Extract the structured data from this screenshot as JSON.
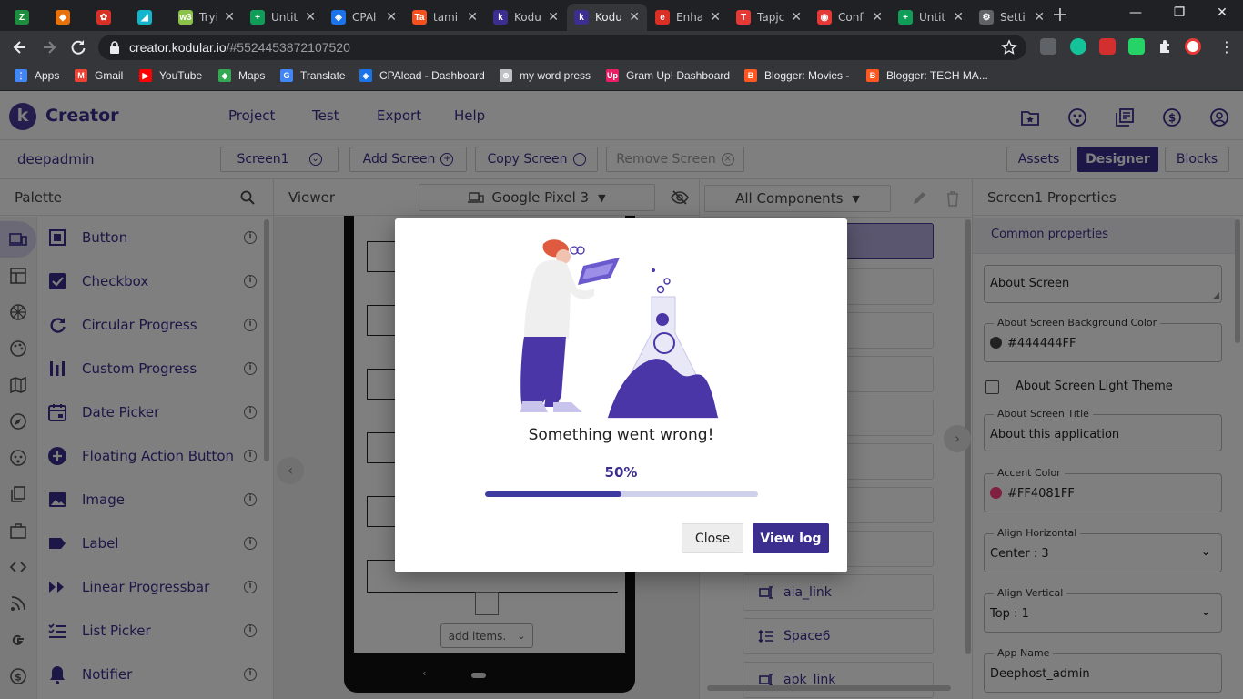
{
  "browser": {
    "tabs": [
      {
        "label": "",
        "color": "#1e8e3e",
        "glyph": "Z"
      },
      {
        "label": "",
        "color": "#e8710a",
        "glyph": "◆"
      },
      {
        "label": "",
        "color": "#d93025",
        "glyph": "✿"
      },
      {
        "label": "",
        "color": "#12b5cb",
        "glyph": "◢"
      },
      {
        "label": "Tryit",
        "color": "#8bc34a",
        "glyph": "w3"
      },
      {
        "label": "Untit",
        "color": "#0f9d58",
        "glyph": "+"
      },
      {
        "label": "CPAl",
        "color": "#1a73e8",
        "glyph": "◈"
      },
      {
        "label": "tami",
        "color": "#f4511e",
        "glyph": "Ta"
      },
      {
        "label": "Kodu",
        "color": "#3b2e8e",
        "glyph": "k"
      },
      {
        "label": "Kodu",
        "color": "#3b2e8e",
        "glyph": "k"
      },
      {
        "label": "Enha",
        "color": "#d93025",
        "glyph": "e"
      },
      {
        "label": "Tapjc",
        "color": "#e53935",
        "glyph": "T"
      },
      {
        "label": "Conf",
        "color": "#e53935",
        "glyph": "◉"
      },
      {
        "label": "Untit",
        "color": "#0f9d58",
        "glyph": "+"
      },
      {
        "label": "Setti",
        "color": "#5f6368",
        "glyph": "⚙"
      }
    ],
    "new_tab": "+",
    "window_controls": [
      "—",
      "❐",
      "✕"
    ],
    "url": "creator.kodular.io",
    "url_path": "/#5524453872107520",
    "bookmarks": [
      {
        "label": "Apps",
        "color": "#4285f4",
        "glyph": "⋮"
      },
      {
        "label": "Gmail",
        "color": "#ea4335",
        "glyph": "M"
      },
      {
        "label": "YouTube",
        "color": "#ff0000",
        "glyph": "▶"
      },
      {
        "label": "Maps",
        "color": "#34a853",
        "glyph": "◆"
      },
      {
        "label": "Translate",
        "color": "#4285f4",
        "glyph": "G"
      },
      {
        "label": "CPAlead - Dashboard",
        "color": "#1a73e8",
        "glyph": "◈"
      },
      {
        "label": "my word press",
        "color": "#bdc1c6",
        "glyph": "⊕"
      },
      {
        "label": "Gram Up! Dashboard",
        "color": "#e91e63",
        "glyph": "Up"
      },
      {
        "label": "Blogger: Movies -",
        "color": "#ff5722",
        "glyph": "B"
      },
      {
        "label": "Blogger: TECH MA...",
        "color": "#ff5722",
        "glyph": "B"
      }
    ]
  },
  "app": {
    "brand": "Creator",
    "logo_letter": "k",
    "menu": [
      "Project",
      "Test",
      "Export",
      "Help"
    ],
    "project_name": "deepadmin",
    "screen_select": "Screen1",
    "add_screen": "Add Screen",
    "copy_screen": "Copy Screen",
    "remove_screen": "Remove Screen",
    "assets": "Assets",
    "designer": "Designer",
    "blocks": "Blocks"
  },
  "palette": {
    "title": "Palette",
    "items": [
      {
        "label": "Button",
        "icon": "button-icon"
      },
      {
        "label": "Checkbox",
        "icon": "checkbox-icon"
      },
      {
        "label": "Circular Progress",
        "icon": "circular-progress-icon"
      },
      {
        "label": "Custom Progress",
        "icon": "custom-progress-icon"
      },
      {
        "label": "Date Picker",
        "icon": "date-picker-icon"
      },
      {
        "label": "Floating Action Button",
        "icon": "fab-icon"
      },
      {
        "label": "Image",
        "icon": "image-icon"
      },
      {
        "label": "Label",
        "icon": "label-icon"
      },
      {
        "label": "Linear Progressbar",
        "icon": "linear-progress-icon"
      },
      {
        "label": "List Picker",
        "icon": "list-picker-icon"
      },
      {
        "label": "Notifier",
        "icon": "notifier-icon"
      }
    ]
  },
  "viewer": {
    "title": "Viewer",
    "device": "Google Pixel 3",
    "add_items": "add items."
  },
  "components": {
    "filter": "All Components",
    "items": [
      {
        "label": "aia_link",
        "icon": "link-component-icon"
      },
      {
        "label": "Space6",
        "icon": "space-component-icon"
      },
      {
        "label": "apk_link",
        "icon": "link-component-icon"
      }
    ]
  },
  "properties": {
    "title": "Screen1 Properties",
    "common_tab": "Common properties",
    "about_screen": "About Screen",
    "bg_color_label": "About Screen Background Color",
    "bg_color_value": "#444444FF",
    "bg_color_hex": "#444444",
    "light_theme_label": "About Screen Light Theme",
    "title_label": "About Screen Title",
    "title_value": "About this application",
    "accent_label": "Accent Color",
    "accent_value": "#FF4081FF",
    "accent_hex": "#FF4081",
    "align_h_label": "Align Horizontal",
    "align_h_value": "Center : 3",
    "align_v_label": "Align Vertical",
    "align_v_value": "Top : 1",
    "app_name_label": "App Name",
    "app_name_value": "Deephost_admin"
  },
  "modal": {
    "title": "Something went wrong!",
    "percent_text": "50%",
    "progress": 0.5,
    "close": "Close",
    "view_log": "View log"
  },
  "colors": {
    "brand": "#3b2e8e",
    "accent": "#4a3a9c"
  }
}
